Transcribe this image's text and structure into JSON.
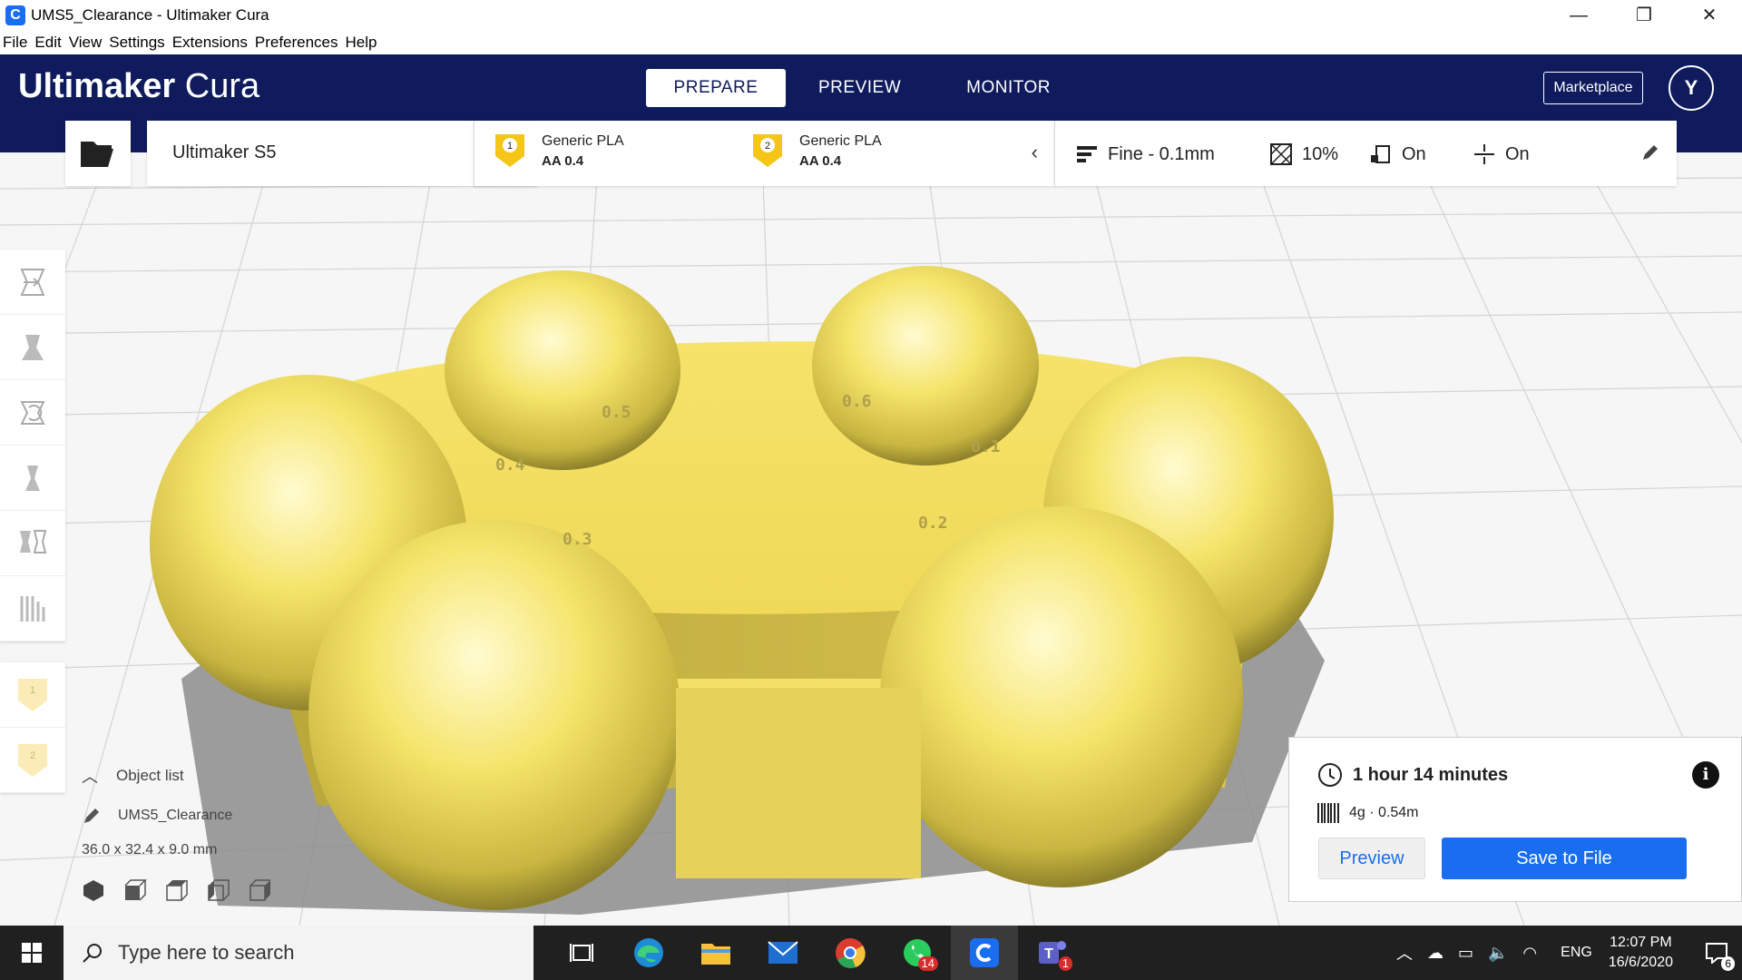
{
  "window": {
    "title": "UMS5_Clearance - Ultimaker Cura",
    "minimize": "—",
    "maximize": "❐",
    "close": "✕"
  },
  "menu": [
    "File",
    "Edit",
    "View",
    "Settings",
    "Extensions",
    "Preferences",
    "Help"
  ],
  "header": {
    "logo_bold": "Ultimaker",
    "logo_light": "Cura",
    "tabs": [
      "PREPARE",
      "PREVIEW",
      "MONITOR"
    ],
    "active_tab": "PREPARE",
    "marketplace": "Marketplace",
    "avatar_initial": "Y"
  },
  "printer": {
    "name": "Ultimaker S5"
  },
  "extruders": [
    {
      "number": "1",
      "material": "Generic PLA",
      "core": "AA 0.4"
    },
    {
      "number": "2",
      "material": "Generic PLA",
      "core": "AA 0.4"
    }
  ],
  "print_settings": {
    "profile": "Fine - 0.1mm",
    "infill": "10%",
    "support": "On",
    "adhesion": "On"
  },
  "object_list": {
    "header": "Object list",
    "item": "UMS5_Clearance",
    "dimensions": "36.0 x 32.4 x 9.0 mm"
  },
  "model_labels": [
    "0.5",
    "0.6",
    "0.4",
    "0.1",
    "0.3",
    "0.2"
  ],
  "print_info": {
    "time": "1 hour 14 minutes",
    "material": "4g · 0.54m",
    "preview": "Preview",
    "save": "Save to File"
  },
  "taskbar": {
    "search_placeholder": "Type here to search",
    "whatsapp_count": "14",
    "teams_count": "1",
    "language": "ENG",
    "time": "12:07 PM",
    "date": "16/6/2020",
    "notification_count": "6"
  },
  "colors": {
    "header": "#0f1b5c",
    "accent": "#196ef0",
    "model": "#f8e66e",
    "extruder_badge": "#f5c518"
  }
}
